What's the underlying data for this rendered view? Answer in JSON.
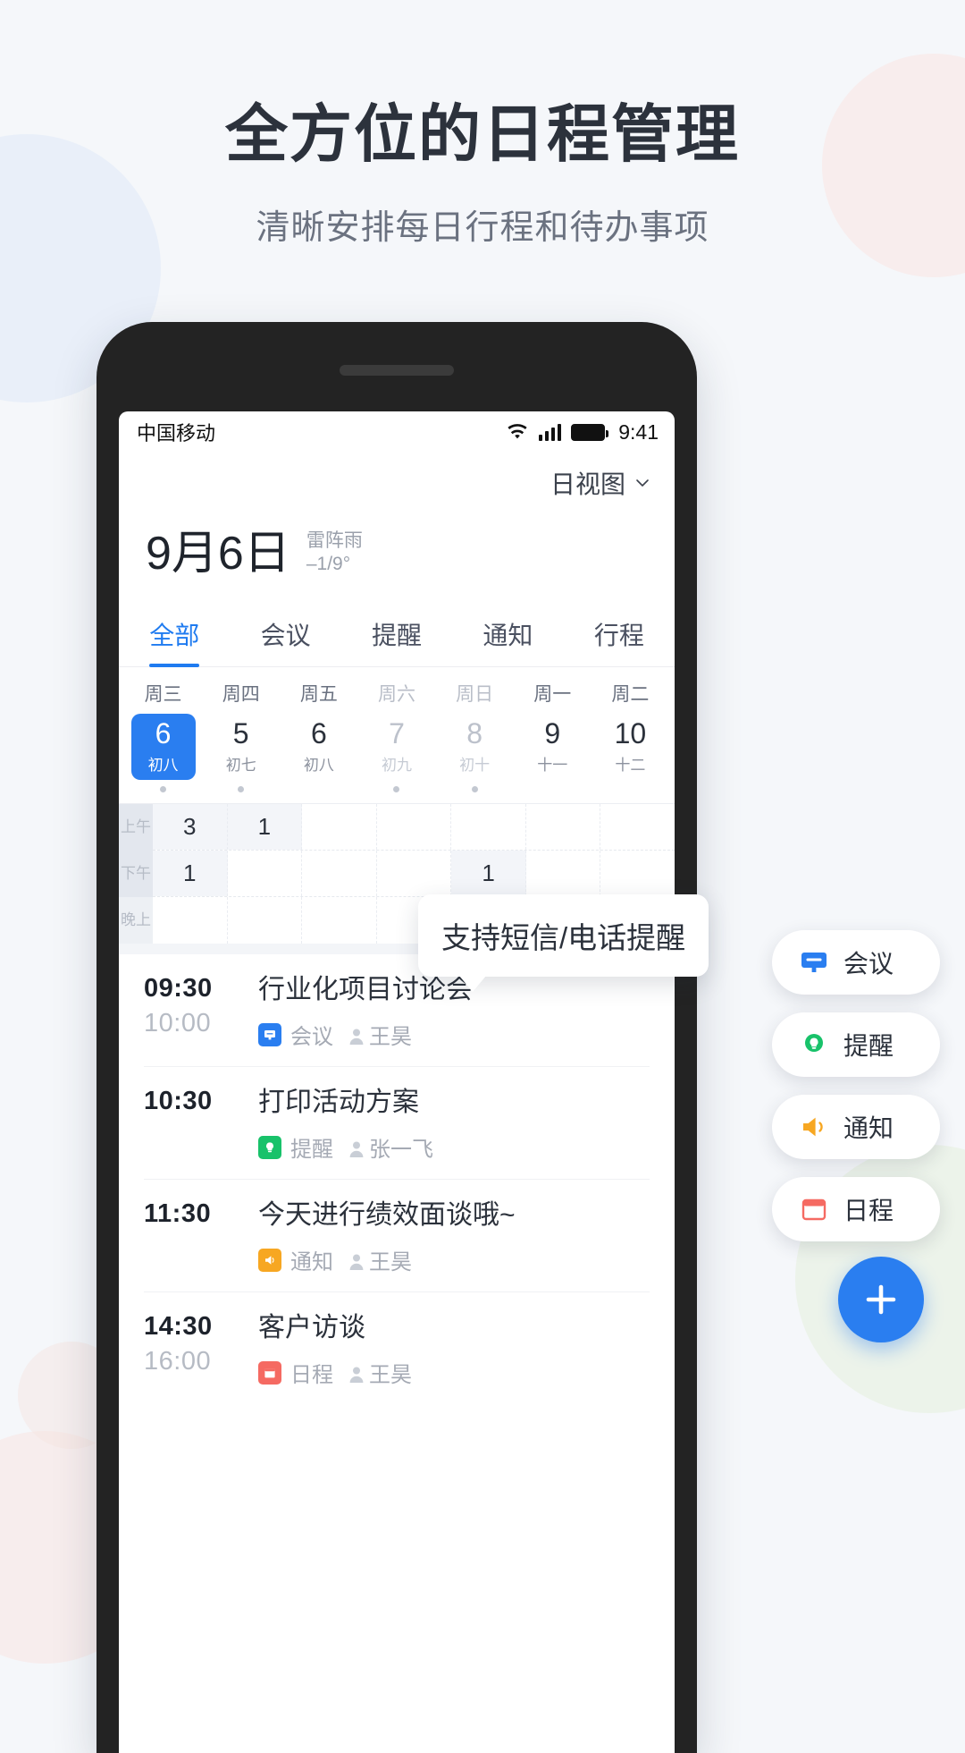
{
  "hero": {
    "title": "全方位的日程管理",
    "subtitle": "清晰安排每日行程和待办事项"
  },
  "statusbar": {
    "carrier": "中国移动",
    "time": "9:41",
    "icons": [
      "wifi-icon",
      "signal-icon",
      "battery-icon"
    ]
  },
  "header": {
    "view_switch": "日视图",
    "chevron": "chevron-down-icon",
    "date": "9月6日",
    "weather_desc": "雷阵雨",
    "weather_temp": "–1/9°"
  },
  "tabs": [
    {
      "label": "全部",
      "active": true
    },
    {
      "label": "会议",
      "active": false
    },
    {
      "label": "提醒",
      "active": false
    },
    {
      "label": "通知",
      "active": false
    },
    {
      "label": "行程",
      "active": false
    }
  ],
  "week": [
    {
      "dow": "周三",
      "day": "6",
      "lunar": "初八",
      "selected": true,
      "muted": false,
      "dot": true
    },
    {
      "dow": "周四",
      "day": "5",
      "lunar": "初七",
      "selected": false,
      "muted": false,
      "dot": true
    },
    {
      "dow": "周五",
      "day": "6",
      "lunar": "初八",
      "selected": false,
      "muted": false,
      "dot": false
    },
    {
      "dow": "周六",
      "day": "7",
      "lunar": "初九",
      "selected": false,
      "muted": true,
      "dot": true
    },
    {
      "dow": "周日",
      "day": "8",
      "lunar": "初十",
      "selected": false,
      "muted": true,
      "dot": true
    },
    {
      "dow": "周一",
      "day": "9",
      "lunar": "十一",
      "selected": false,
      "muted": false,
      "dot": false
    },
    {
      "dow": "周二",
      "day": "10",
      "lunar": "十二",
      "selected": false,
      "muted": false,
      "dot": false
    }
  ],
  "timegrid": {
    "row_labels": [
      "上午",
      "下午",
      "晚上"
    ],
    "rows": [
      [
        "3",
        "1",
        "",
        "",
        "",
        "",
        ""
      ],
      [
        "1",
        "",
        "",
        "",
        "1",
        "",
        ""
      ],
      [
        "",
        "",
        "",
        "",
        "",
        "",
        ""
      ]
    ]
  },
  "events": [
    {
      "start": "09:30",
      "end": "10:00",
      "title": "行业化项目讨论会",
      "type": "会议",
      "type_icon": "meeting-icon",
      "type_color": "#2a7ef0",
      "person": "王昊"
    },
    {
      "start": "10:30",
      "end": "",
      "title": "打印活动方案",
      "type": "提醒",
      "type_icon": "reminder-icon",
      "type_color": "#18c26a",
      "person": "张一飞"
    },
    {
      "start": "11:30",
      "end": "",
      "title": "今天进行绩效面谈哦~",
      "type": "通知",
      "type_icon": "notice-icon",
      "type_color": "#f7a722",
      "person": "王昊"
    },
    {
      "start": "14:30",
      "end": "16:00",
      "title": "客户访谈",
      "type": "日程",
      "type_icon": "schedule-icon",
      "type_color": "#f56a62",
      "person": "王昊"
    }
  ],
  "chips": [
    {
      "label": "会议",
      "icon": "meeting-icon",
      "color": "#2a7ef0"
    },
    {
      "label": "提醒",
      "icon": "reminder-icon",
      "color": "#18c26a"
    },
    {
      "label": "通知",
      "icon": "notice-icon",
      "color": "#f7a722"
    },
    {
      "label": "日程",
      "icon": "schedule-icon",
      "color": "#f56a62"
    }
  ],
  "tooltip": {
    "text": "支持短信/电话提醒"
  },
  "fab": {
    "icon": "plus-icon",
    "color": "#2a7ef0"
  }
}
